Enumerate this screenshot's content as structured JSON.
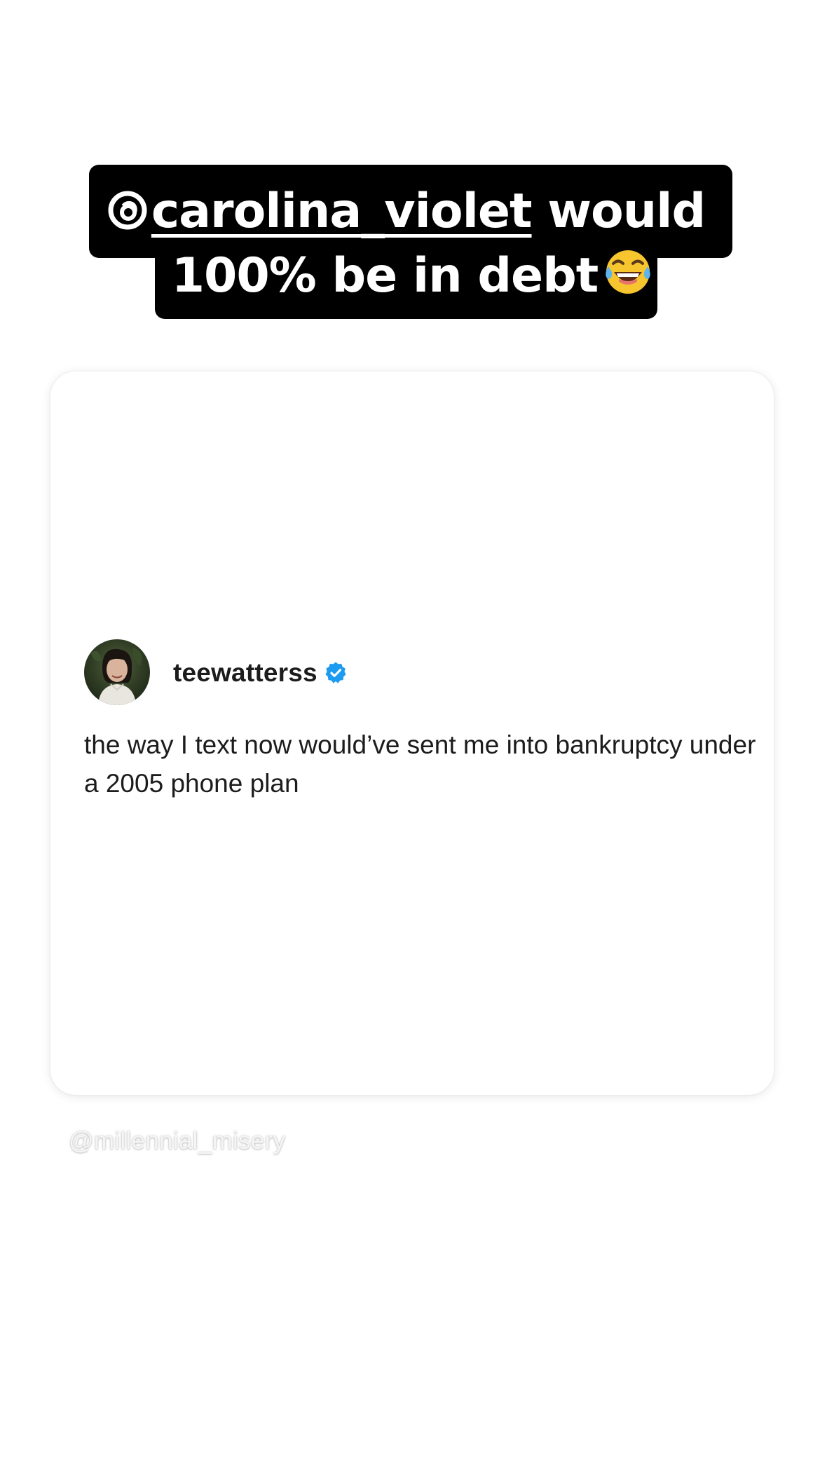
{
  "story": {
    "caption": {
      "mention": "carolina_violet",
      "line1_rest": " would",
      "line2": "100% be in debt",
      "mention_icon": "threads-icon",
      "emoji": "face-with-tears-of-joy-emoji"
    },
    "post": {
      "username": "teewatterss",
      "verified_icon": "verified-badge-icon",
      "text": "the way I text now would’ve sent me into bankruptcy under a 2005 phone plan"
    },
    "watermark": "@millennial_misery"
  },
  "colors": {
    "background": "#ffffff",
    "caption_bg": "#000000",
    "caption_text": "#ffffff",
    "verified": "#1d9bf0",
    "post_text": "#1c1c1c"
  }
}
